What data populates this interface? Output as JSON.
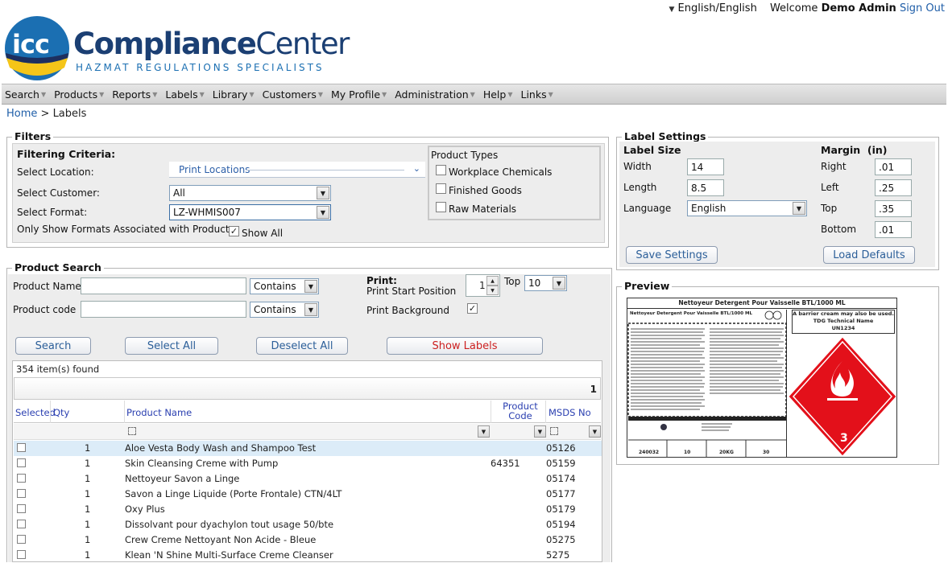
{
  "header": {
    "language": "English/English",
    "welcome": "Welcome",
    "user": "Demo Admin",
    "signout": "Sign Out"
  },
  "logo": {
    "mark": "icc",
    "name_bold": "Compliance",
    "name_regular": "Center",
    "tagline": "HAZMAT  REGULATIONS SPECIALISTS",
    "colors": {
      "blue": "#1b6fb2",
      "navy": "#1d2f5f",
      "yellow": "#f5c518",
      "text": "#1b3f73"
    }
  },
  "menu": [
    "Search",
    "Products",
    "Reports",
    "Labels",
    "Library",
    "Customers",
    "My Profile",
    "Administration",
    "Help",
    "Links"
  ],
  "breadcrumb": {
    "home": "Home",
    "separator": " > ",
    "current": "Labels"
  },
  "filters": {
    "title": "Filters",
    "criteria_title": "Filtering Criteria:",
    "location_label": "Select Location:",
    "location_value": "Print Locations",
    "customer_label": "Select Customer:",
    "customer_value": "All",
    "format_label": "Select Format:",
    "format_value": "LZ-WHMIS007",
    "only_show_label": "Only Show Formats Associated with Products",
    "show_all_label": "Show All",
    "product_types_title": "Product Types",
    "types": [
      "Workplace Chemicals",
      "Finished Goods",
      "Raw Materials"
    ]
  },
  "product_search": {
    "title": "Product Search",
    "name_label": "Product Name",
    "code_label": "Product code",
    "contains": "Contains",
    "print_title": "Print:",
    "start_position_label": "Print Start Position",
    "start_position_value": "1",
    "top_label": "Top",
    "top_value": "10",
    "background_label": "Print Background",
    "buttons": {
      "search": "Search",
      "select_all": "Select All",
      "deselect_all": "Deselect All",
      "show_labels": "Show Labels"
    },
    "found": "354 item(s) found",
    "page": "1"
  },
  "grid": {
    "headers": {
      "selected": "Selected",
      "qty": "Qty",
      "product_name": "Product Name",
      "product_code": "Product Code",
      "msds": "MSDS No"
    },
    "rows": [
      {
        "qty": "1",
        "name": "Aloe Vesta Body Wash and Shampoo Test",
        "code": "",
        "msds": "05126"
      },
      {
        "qty": "1",
        "name": "Skin Cleansing Creme with Pump",
        "code": "64351",
        "msds": "05159"
      },
      {
        "qty": "1",
        "name": "Nettoyeur Savon a Linge",
        "code": "",
        "msds": "05174"
      },
      {
        "qty": "1",
        "name": "Savon a Linge Liquide (Porte Frontale) CTN/4LT",
        "code": "",
        "msds": "05177"
      },
      {
        "qty": "1",
        "name": "Oxy Plus",
        "code": "",
        "msds": "05179"
      },
      {
        "qty": "1",
        "name": "Dissolvant pour dyachylon tout usage 50/bte",
        "code": "",
        "msds": "05194"
      },
      {
        "qty": "1",
        "name": "Crew Creme Nettoyant Non Acide - Bleue",
        "code": "",
        "msds": "05275"
      },
      {
        "qty": "1",
        "name": "Klean 'N Shine Multi-Surface Creme Cleanser",
        "code": "",
        "msds": "5275"
      }
    ]
  },
  "label_settings": {
    "title": "Label Settings",
    "size_title": "Label Size",
    "margin_title": "Margin  (in)",
    "width_label": "Width",
    "width_value": "14",
    "length_label": "Length",
    "length_value": "8.5",
    "language_label": "Language",
    "language_value": "English",
    "right_label": "Right",
    "right_value": ".01",
    "left_label": "Left",
    "left_value": ".25",
    "top_label": "Top",
    "top_value": ".35",
    "bottom_label": "Bottom",
    "bottom_value": ".01",
    "save": "Save Settings",
    "load": "Load Defaults"
  },
  "preview": {
    "title": "Preview",
    "label_title": "Nettoyeur Detergent Pour Vaisselle BTL/1000 ML",
    "sub_title": "Nettoyeur Detergent Pour Vaisselle BTL/1000 ML",
    "warning": "A barrier cream may also be used.",
    "contact": "TDG Technical Name",
    "un": "UN1234",
    "hazard_class": "3",
    "footer_values": [
      "240032",
      "10",
      "20KG",
      "30"
    ],
    "colors": {
      "hazard_red": "#e3101a"
    }
  }
}
